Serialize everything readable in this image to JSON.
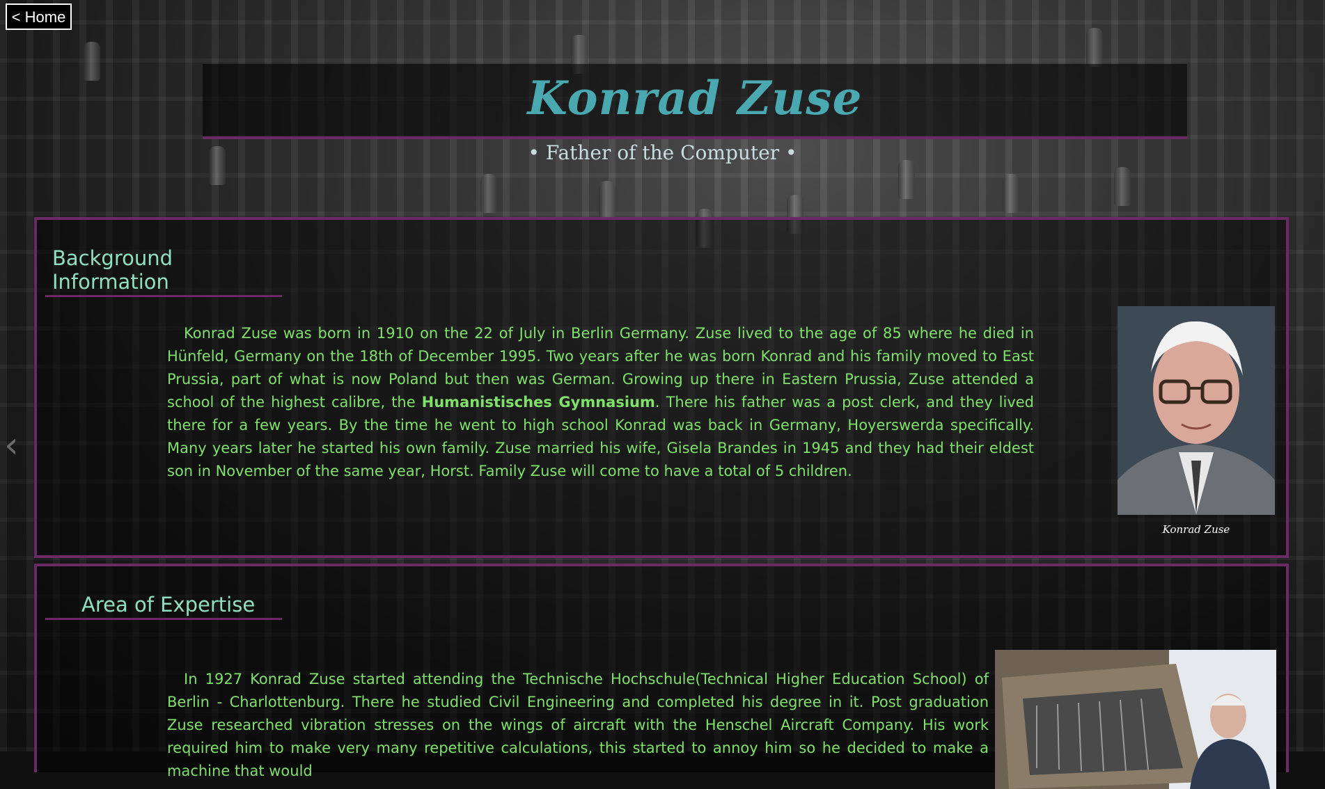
{
  "nav": {
    "home_label": "< Home"
  },
  "header": {
    "title": "Konrad Zuse",
    "subtitle": "• Father of the Computer •"
  },
  "sections": [
    {
      "heading": "Background Information",
      "paragraph_part1": "Konrad Zuse was born in 1910 on the 22 of July in Berlin Germany. Zuse lived to the age of 85 where he died in Hünfeld, Germany on the 18th of December 1995. Two years after he was born Konrad and his family moved to East Prussia, part of what is now Poland but then was German. Growing up there in Eastern Prussia, Zuse attended a school of the highest calibre, the ",
      "paragraph_bold": "Humanistisches Gymnasium",
      "paragraph_part2": ". There his father was a post clerk, and they lived there for a few years. By the time he went to high school Konrad was back in Germany, Hoyerswerda specifically. Many years later he started his own family. Zuse married his wife, Gisela Brandes in 1945 and they had their eldest son in November of the same year, Horst. Family Zuse will come to have a total of 5 children.",
      "image_caption": "Konrad Zuse"
    },
    {
      "heading": "Area of Expertise",
      "paragraph": "In 1927 Konrad Zuse started attending the Technische Hochschule(Technical Higher Education School) of Berlin - Charlottenburg. There he studied Civil Engineering and completed his degree in it. Post graduation Zuse researched vibration stresses on the wings of aircraft with the Henschel Aircraft Company. His work required him to make very many repetitive calculations, this started to annoy him so he decided to make a machine that would"
    }
  ],
  "colors": {
    "accent_border": "#6b2a66",
    "title": "#4aa8b0",
    "heading": "#8fe0c0",
    "body_text": "#7fe06a"
  },
  "icons": {
    "carousel_prev": "chevron-left-icon"
  }
}
